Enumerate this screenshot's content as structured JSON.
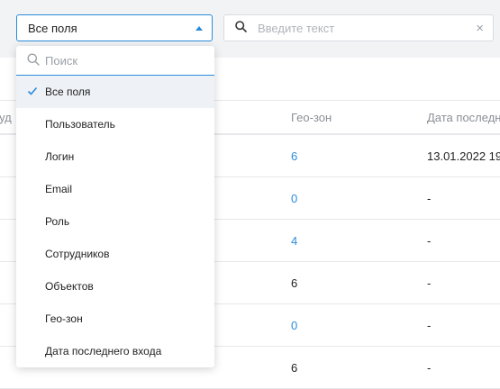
{
  "filter": {
    "selected_label": "Все поля"
  },
  "search": {
    "placeholder": "Введите текст",
    "clear_glyph": "×"
  },
  "dropdown": {
    "search_placeholder": "Поиск",
    "options": [
      {
        "label": "Все поля",
        "selected": true
      },
      {
        "label": "Пользователь",
        "selected": false
      },
      {
        "label": "Логин",
        "selected": false
      },
      {
        "label": "Email",
        "selected": false
      },
      {
        "label": "Роль",
        "selected": false
      },
      {
        "label": "Сотрудников",
        "selected": false
      },
      {
        "label": "Объектов",
        "selected": false
      },
      {
        "label": "Гео-зон",
        "selected": false
      },
      {
        "label": "Дата последнего входа",
        "selected": false
      }
    ]
  },
  "table": {
    "headers": {
      "partial_left": "руд",
      "geozones": "Гео-зон",
      "last_login": "Дата последн"
    },
    "rows": [
      {
        "geozones": "6",
        "geozones_link": true,
        "last_login": "13.01.2022 19"
      },
      {
        "geozones": "0",
        "geozones_link": true,
        "last_login": "-"
      },
      {
        "geozones": "4",
        "geozones_link": true,
        "last_login": "-"
      },
      {
        "geozones": "6",
        "geozones_link": false,
        "last_login": "-"
      },
      {
        "geozones": "0",
        "geozones_link": true,
        "last_login": "-"
      },
      {
        "geozones": "6",
        "geozones_link": false,
        "last_login": "-"
      }
    ]
  },
  "colors": {
    "accent": "#2a8bdb",
    "selected_bg": "#eef1f5",
    "topbar_bg": "#f2f3f5"
  }
}
